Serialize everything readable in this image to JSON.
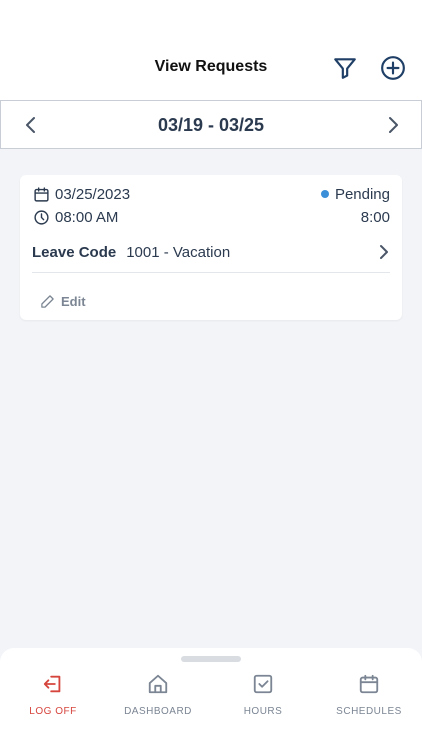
{
  "header": {
    "title": "View Requests",
    "filter_icon": "filter-icon",
    "add_icon": "add-circle-icon"
  },
  "week": {
    "range": "03/19 - 03/25",
    "prev_icon": "chevron-left-icon",
    "next_icon": "chevron-right-icon"
  },
  "request": {
    "date": "03/25/2023",
    "time": "08:00 AM",
    "status": "Pending",
    "hours": "8:00",
    "leave_code_label": "Leave Code",
    "leave_code_value": "1001 - Vacation",
    "edit_label": "Edit",
    "status_color": "#3b8fd8"
  },
  "nav": {
    "items": [
      {
        "label": "LOG OFF",
        "icon": "logout-icon",
        "color": "#d6453d"
      },
      {
        "label": "DASHBOARD",
        "icon": "home-icon"
      },
      {
        "label": "HOURS",
        "icon": "checkbox-icon"
      },
      {
        "label": "SCHEDULES",
        "icon": "calendar-icon"
      }
    ]
  }
}
